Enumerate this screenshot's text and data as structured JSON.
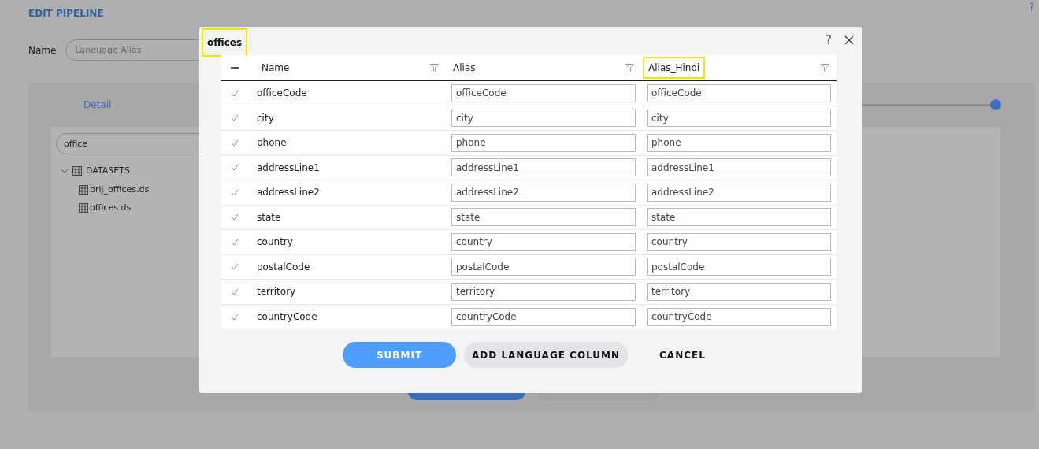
{
  "page": {
    "title": "EDIT PIPELINE",
    "help": "?",
    "name_label": "Name",
    "name_placeholder": "Language Alias",
    "tab": "Detail",
    "slider": {
      "level": 1
    },
    "search_value": "office",
    "tree": {
      "label": "DATASETS",
      "expanded": true,
      "children": [
        {
          "label": "brij_offices.ds"
        },
        {
          "label": "offices.ds"
        }
      ]
    }
  },
  "dialog": {
    "title": "offices",
    "title_highlighted": true,
    "help": "?",
    "columns": [
      {
        "label": "Name",
        "highlighted": false
      },
      {
        "label": "Alias",
        "highlighted": false
      },
      {
        "label": "Alias_Hindi",
        "highlighted": true
      }
    ],
    "select_all_indeterminate": true,
    "rows": [
      {
        "name": "officeCode",
        "alias": "officeCode",
        "alias_hindi": "officeCode",
        "checked": true
      },
      {
        "name": "city",
        "alias": "city",
        "alias_hindi": "city",
        "checked": true
      },
      {
        "name": "phone",
        "alias": "phone",
        "alias_hindi": "phone",
        "checked": true
      },
      {
        "name": "addressLine1",
        "alias": "addressLine1",
        "alias_hindi": "addressLine1",
        "checked": true
      },
      {
        "name": "addressLine2",
        "alias": "addressLine2",
        "alias_hindi": "addressLine2",
        "checked": true
      },
      {
        "name": "state",
        "alias": "state",
        "alias_hindi": "state",
        "checked": true
      },
      {
        "name": "country",
        "alias": "country",
        "alias_hindi": "country",
        "checked": true
      },
      {
        "name": "postalCode",
        "alias": "postalCode",
        "alias_hindi": "postalCode",
        "checked": true
      },
      {
        "name": "territory",
        "alias": "territory",
        "alias_hindi": "territory",
        "checked": true
      },
      {
        "name": "countryCode",
        "alias": "countryCode",
        "alias_hindi": "countryCode",
        "checked": true
      }
    ],
    "buttons": [
      {
        "label": "SUBMIT",
        "kind": "primary"
      },
      {
        "label": "ADD LANGUAGE COLUMN",
        "kind": "secondary"
      },
      {
        "label": "CANCEL",
        "kind": "text"
      }
    ]
  }
}
